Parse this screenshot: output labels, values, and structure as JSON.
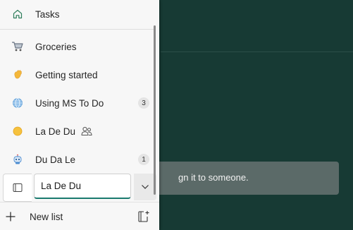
{
  "background": {
    "task_hint_text": "gn it to someone."
  },
  "sidebar": {
    "tasks_label": "Tasks",
    "lists": [
      {
        "label": "Groceries",
        "icon": "cart-icon"
      },
      {
        "label": "Getting started",
        "icon": "waving-hand-icon"
      },
      {
        "label": "Using MS To Do",
        "icon": "globe-icon",
        "count": "3"
      },
      {
        "label": "La De Du",
        "icon": "sun-icon",
        "shared": true
      },
      {
        "label": "Du Da Le",
        "icon": "robot-icon",
        "count": "1"
      }
    ],
    "group_input_value": "La De Du",
    "new_list_label": "New list"
  },
  "colors": {
    "app_background": "#173a34",
    "panel_background": "#f7f7f7",
    "accent": "#1a7a6e",
    "tasks_icon": "#2e7d5b"
  }
}
